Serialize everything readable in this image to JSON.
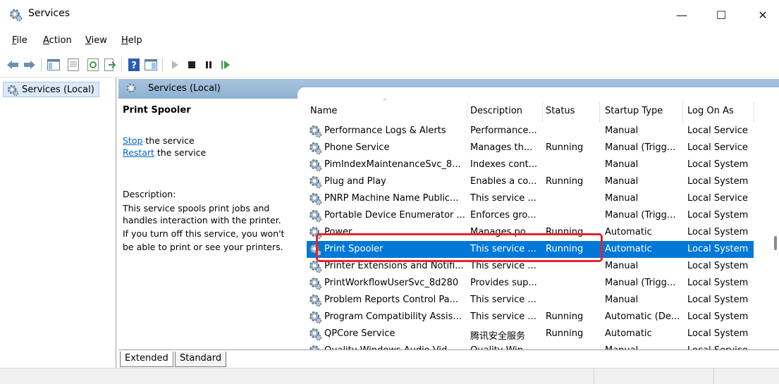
{
  "window": {
    "title": "Services",
    "icon": "services-gear-icon",
    "minimize_glyph": "—",
    "maximize_glyph": "☐",
    "close_glyph": "✕"
  },
  "menu": {
    "file": {
      "hot": "F",
      "rest": "ile"
    },
    "action": {
      "hot": "A",
      "rest": "ction"
    },
    "view": {
      "hot": "V",
      "rest": "iew"
    },
    "help": {
      "hot": "H",
      "rest": "elp"
    }
  },
  "toolbar": {
    "icons": [
      "back-icon",
      "forward-icon",
      "show-hide-tree-icon",
      "properties-icon",
      "refresh-icon",
      "export-list-icon",
      "help-icon",
      "console-view-icon",
      "start-service-icon",
      "stop-service-icon",
      "pause-service-icon",
      "resume-service-icon"
    ]
  },
  "tree": {
    "selected_item": "Services (Local)"
  },
  "pane": {
    "header_title": "Services (Local)"
  },
  "details": {
    "service_name": "Print Spooler",
    "stop_link": "Stop",
    "stop_suffix": " the service",
    "restart_link": "Restart",
    "restart_suffix": " the service",
    "description_label": "Description:",
    "description_lines": [
      "This service spools print jobs and",
      "handles interaction with the printer.",
      "If you turn off this service, you won't",
      "be able to print or see your printers."
    ]
  },
  "columns": {
    "name": "Name",
    "description": "Description",
    "status": "Status",
    "startup_type": "Startup Type",
    "log_on_as": "Log On As"
  },
  "services": [
    {
      "name": "Performance Logs & Alerts",
      "description": "Performance...",
      "status": "",
      "startup": "Manual",
      "logon": "Local Service"
    },
    {
      "name": "Phone Service",
      "description": "Manages th...",
      "status": "Running",
      "startup": "Manual (Trigg...",
      "logon": "Local Service"
    },
    {
      "name": "PimIndexMaintenanceSvc_8...",
      "description": "Indexes cont...",
      "status": "",
      "startup": "Manual",
      "logon": "Local System"
    },
    {
      "name": "Plug and Play",
      "description": "Enables a co...",
      "status": "Running",
      "startup": "Manual",
      "logon": "Local System"
    },
    {
      "name": "PNRP Machine Name Public...",
      "description": "This service ...",
      "status": "",
      "startup": "Manual",
      "logon": "Local Service"
    },
    {
      "name": "Portable Device Enumerator ...",
      "description": "Enforces gro...",
      "status": "",
      "startup": "Manual (Trigg...",
      "logon": "Local System"
    },
    {
      "name": "Power",
      "description": "Manages po...",
      "status": "Running",
      "startup": "Automatic",
      "logon": "Local System"
    },
    {
      "name": "Print Spooler",
      "description": "This service ...",
      "status": "Running",
      "startup": "Automatic",
      "logon": "Local System",
      "selected": true
    },
    {
      "name": "Printer Extensions and Notifi...",
      "description": "This service ...",
      "status": "",
      "startup": "Manual",
      "logon": "Local System"
    },
    {
      "name": "PrintWorkflowUserSvc_8d280",
      "description": "Provides sup...",
      "status": "",
      "startup": "Manual (Trigg...",
      "logon": "Local System"
    },
    {
      "name": "Problem Reports Control Pa...",
      "description": "This service ...",
      "status": "",
      "startup": "Manual",
      "logon": "Local System"
    },
    {
      "name": "Program Compatibility Assis...",
      "description": "This service ...",
      "status": "Running",
      "startup": "Automatic (De...",
      "logon": "Local System"
    },
    {
      "name": "QPCore Service",
      "description": "腾讯安全服务",
      "status": "Running",
      "startup": "Automatic",
      "logon": "Local System"
    },
    {
      "name": "Quality Windows Audio Vid...",
      "description": "Quality Win...",
      "status": "",
      "startup": "Manual",
      "logon": "Local Service"
    }
  ],
  "tabs": {
    "extended": "Extended",
    "standard": "Standard"
  },
  "colors": {
    "selection": "#0078d7",
    "highlight_box": "#e5262a",
    "header_gradient": "#a8c3de"
  }
}
